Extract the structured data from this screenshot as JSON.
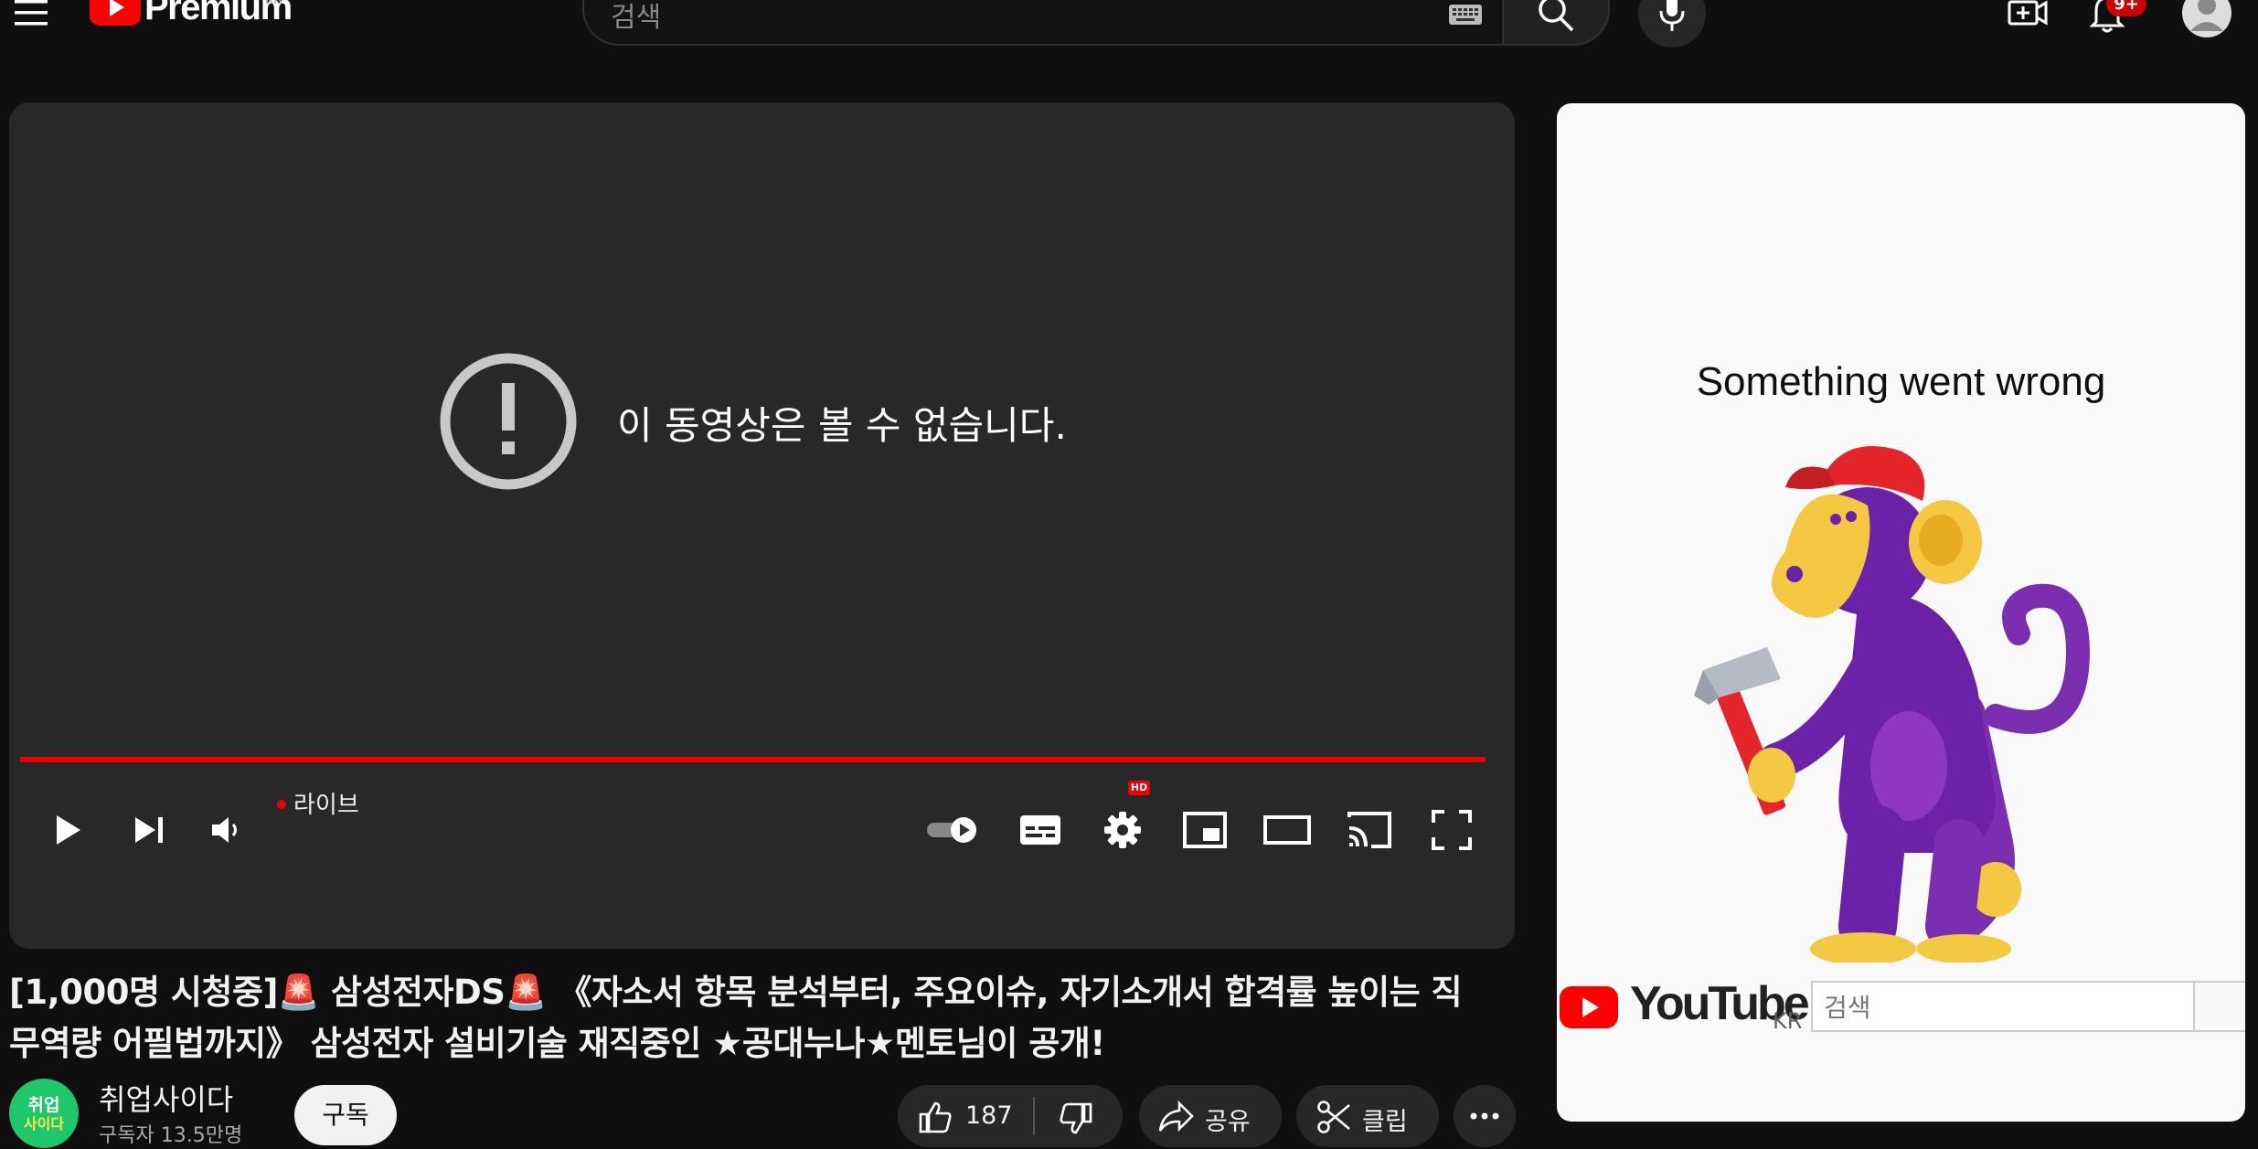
{
  "header": {
    "logo_text": "Premium",
    "country_code": "KR",
    "search_placeholder": "검색",
    "notification_count": "9+",
    "icons": [
      "menu-icon",
      "youtube-logo-icon",
      "keyboard-icon",
      "search-icon",
      "mic-icon",
      "create-icon",
      "bell-icon",
      "avatar-icon"
    ]
  },
  "player": {
    "error_message": "이 동영상은 볼 수 없습니다.",
    "live_label": "라이브",
    "hd_badge": "HD",
    "progress_fraction": 1.0,
    "colors": {
      "progress": "#ee0000",
      "background": "#282828"
    },
    "controls": [
      "play-icon",
      "next-icon",
      "volume-icon",
      "autoplay-toggle-icon",
      "subtitles-icon",
      "settings-icon",
      "miniplayer-icon",
      "theater-icon",
      "cast-icon",
      "fullscreen-icon"
    ]
  },
  "video": {
    "title_line1": "[1,000명 시청중]🚨 삼성전자DS🚨 《자소서 항목 분석부터, 주요이슈, 자기소개서 합격률 높이는 직",
    "title_line2": "무역량 어필법까지》 삼성전자 설비기술 재직중인 ★공대누나★멘토님이 공개!",
    "channel_avatar_line1": "취업",
    "channel_avatar_line2": "사이다",
    "channel_name": "취업사이다",
    "subscribers": "구독자 13.5만명",
    "subscribe_label": "구독",
    "like_count": "187",
    "share_label": "공유",
    "clip_label": "클립"
  },
  "error_panel": {
    "message": "Something went wrong",
    "logo_text": "YouTube",
    "country_code": "KR",
    "search_placeholder": "검색"
  }
}
